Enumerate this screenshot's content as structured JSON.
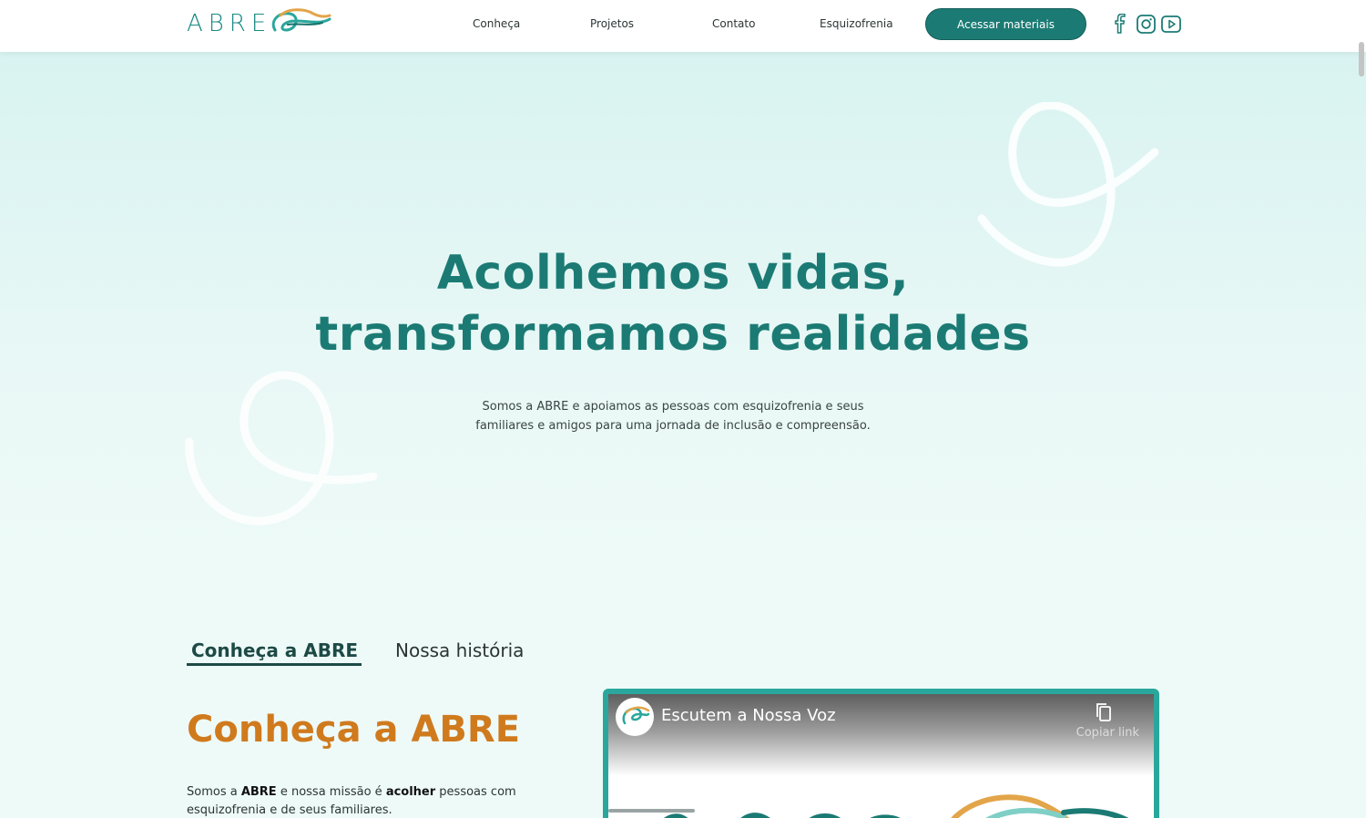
{
  "header": {
    "logo_text": "ABRE",
    "nav": [
      {
        "label": "Conheça"
      },
      {
        "label": "Projetos"
      },
      {
        "label": "Contato"
      },
      {
        "label": "Esquizofrenia"
      }
    ],
    "cta_label": "Acessar materiais",
    "social": [
      "facebook-icon",
      "instagram-icon",
      "youtube-icon"
    ]
  },
  "hero": {
    "title_line1": "Acolhemos vidas,",
    "title_line2": "transformamos realidades",
    "subtitle_line1": "Somos a ABRE e apoiamos as pessoas com esquizofrenia e seus",
    "subtitle_line2": "familiares e amigos para uma jornada de inclusão e compreensão."
  },
  "tabs": [
    {
      "label": "Conheça a ABRE",
      "active": true
    },
    {
      "label": "Nossa história",
      "active": false
    }
  ],
  "section": {
    "title": "Conheça a ABRE",
    "intro_p1": "Somos a ",
    "intro_b1": "ABRE",
    "intro_p2": " e nossa missão é ",
    "intro_b2": "acolher",
    "intro_p3": " pessoas com esquizofrenia e de seus familiares."
  },
  "video": {
    "title": "Escutem a Nossa Voz",
    "copy_label": "Copiar link"
  },
  "colors": {
    "brand_teal": "#1b7b74",
    "accent_orange": "#d07a1e",
    "video_border": "#2aa79c"
  }
}
